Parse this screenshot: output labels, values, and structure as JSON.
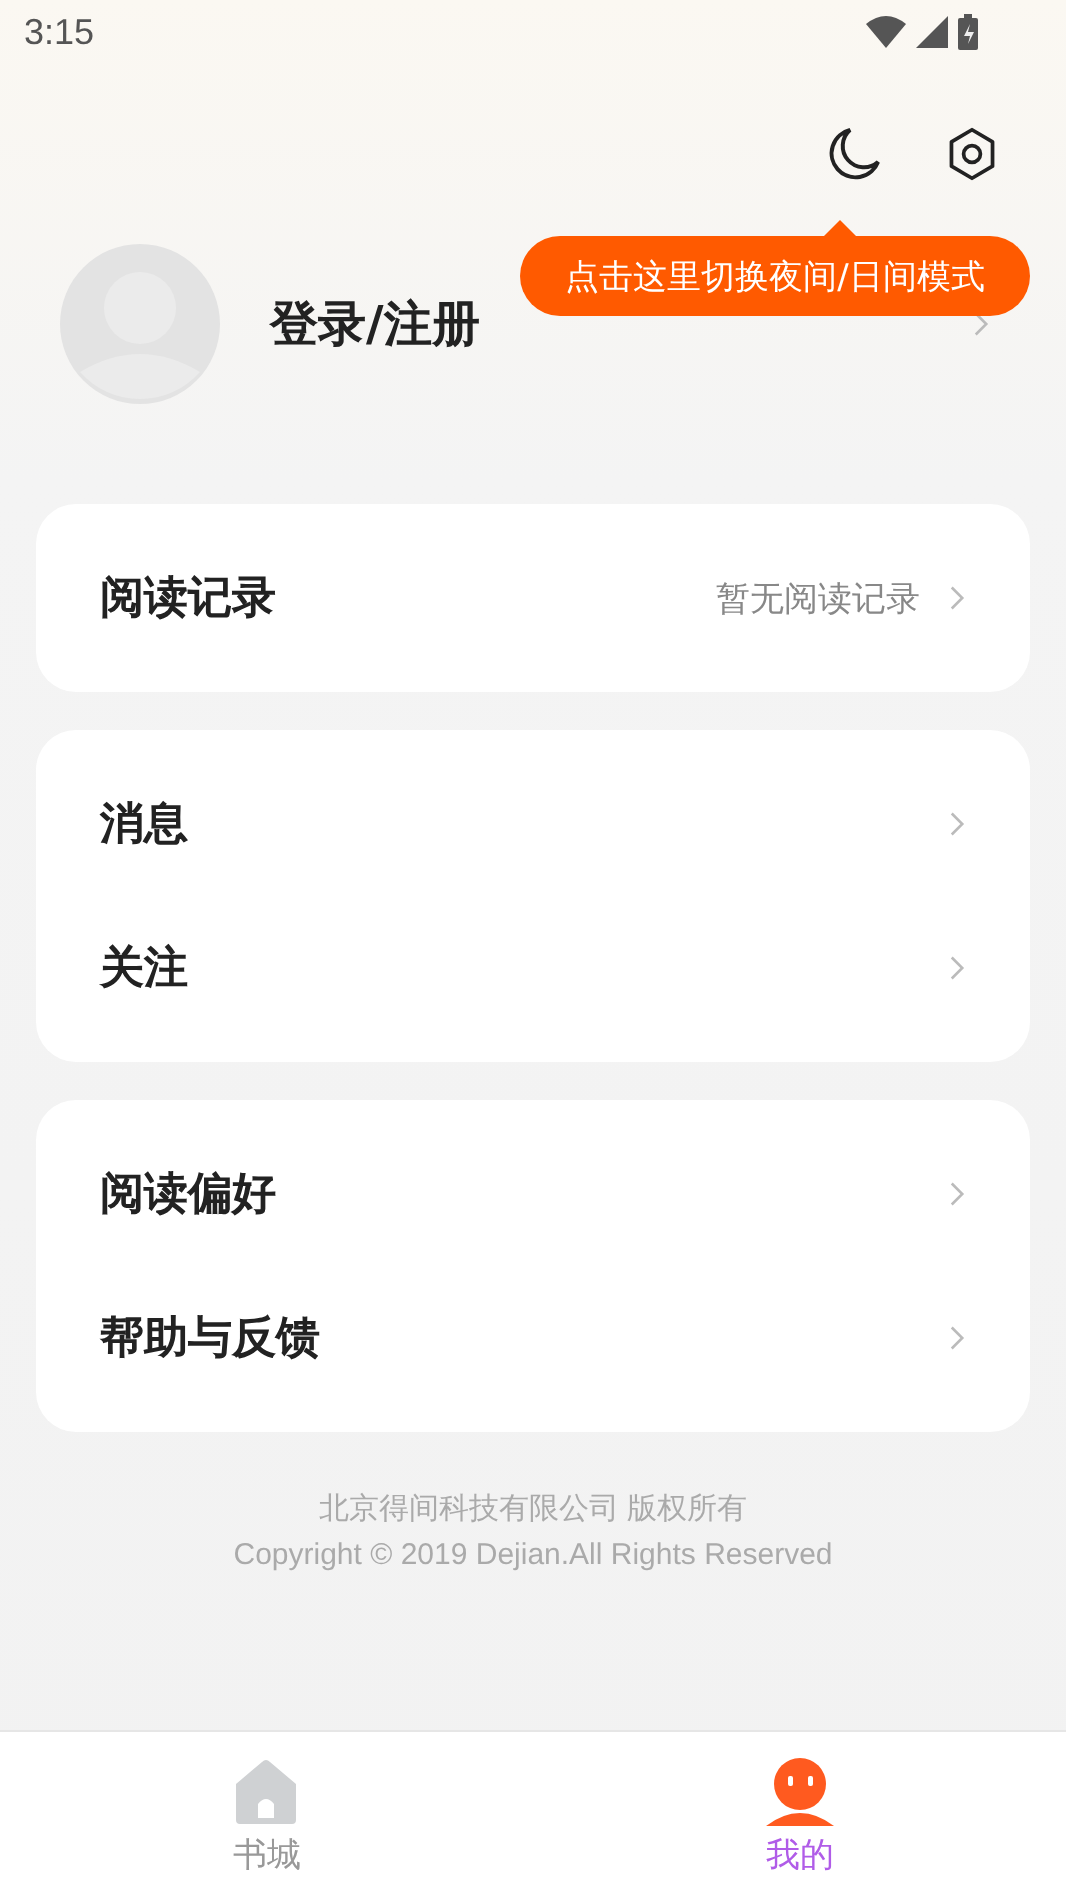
{
  "status_bar": {
    "time": "3:15"
  },
  "header": {
    "tooltip": "点击这里切换夜间/日间模式"
  },
  "profile": {
    "label": "登录/注册"
  },
  "cards": [
    {
      "rows": [
        {
          "label": "阅读记录",
          "value": "暂无阅读记录"
        }
      ]
    },
    {
      "rows": [
        {
          "label": "消息"
        },
        {
          "label": "关注"
        }
      ]
    },
    {
      "rows": [
        {
          "label": "阅读偏好"
        },
        {
          "label": "帮助与反馈"
        }
      ]
    }
  ],
  "footer": {
    "company": "北京得间科技有限公司  版权所有",
    "copyright": "Copyright © 2019 Dejian.All Rights Reserved"
  },
  "tabs": [
    {
      "label": "书城",
      "selected": false,
      "kind": "home"
    },
    {
      "label": "我的",
      "selected": true,
      "kind": "person"
    }
  ]
}
